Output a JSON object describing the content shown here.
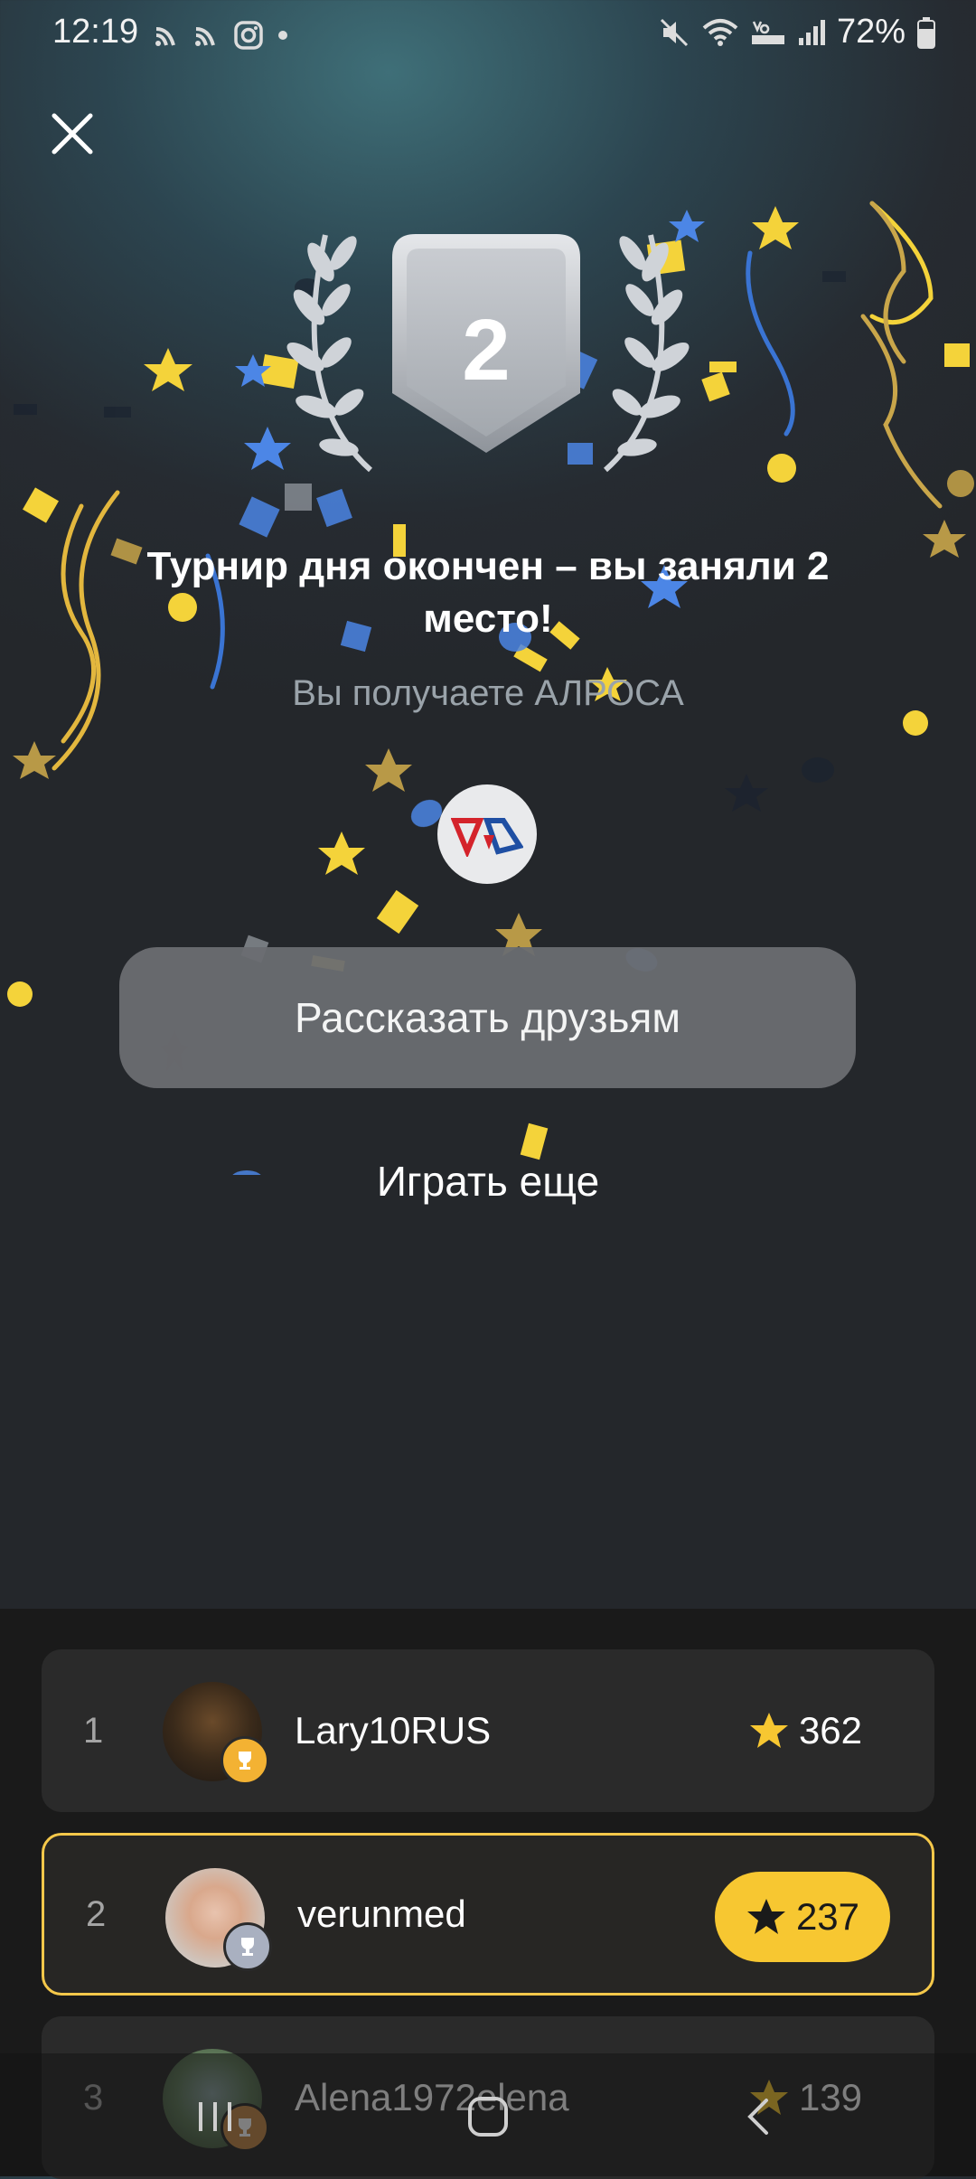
{
  "status_bar": {
    "time": "12:19",
    "battery": "72%"
  },
  "result": {
    "place_number": "2",
    "title": "Турнир дня окончен – вы заняли 2 место!",
    "subtitle": "Вы получаете АЛРОСА"
  },
  "actions": {
    "share_label": "Рассказать друзьям",
    "play_again_label": "Играть еще"
  },
  "leaderboard": {
    "rows": [
      {
        "rank": "1",
        "name": "Lary10RUS",
        "score": "362"
      },
      {
        "rank": "2",
        "name": "verunmed",
        "score": "237"
      },
      {
        "rank": "3",
        "name": "Alena1972elena",
        "score": "139"
      }
    ]
  },
  "colors": {
    "accent": "#f7c731",
    "gold_cup": "#f3b233",
    "silver_cup": "#a9b0c0",
    "bronze_cup": "#c58a4a"
  }
}
